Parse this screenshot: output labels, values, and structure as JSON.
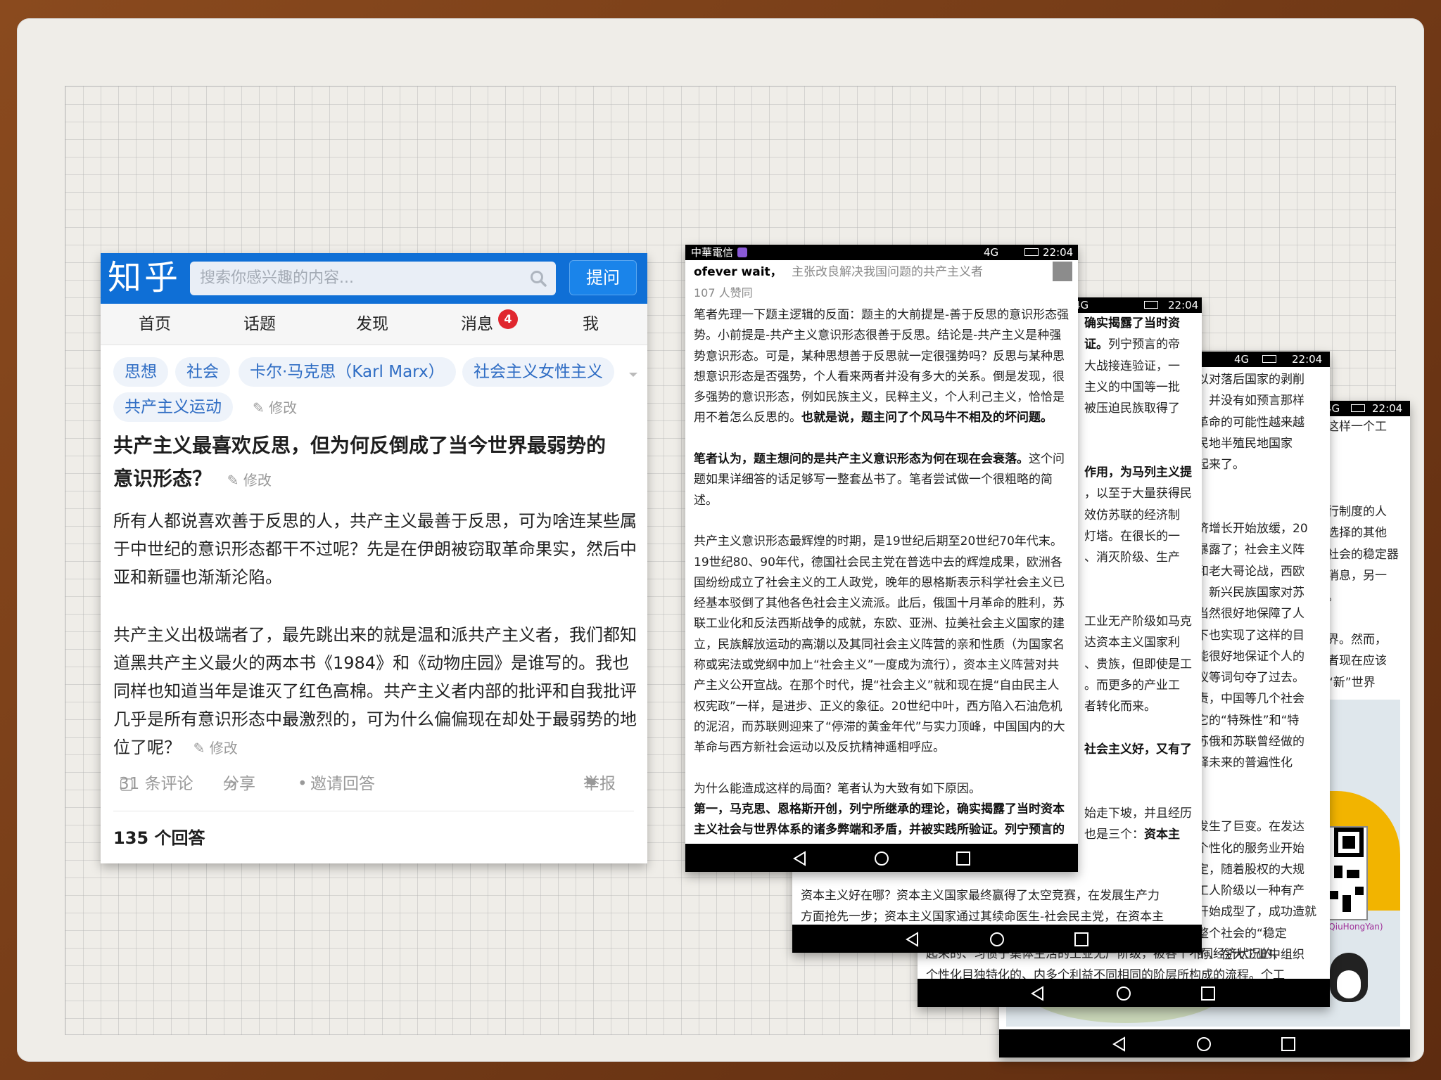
{
  "zhihu": {
    "logo": "知乎",
    "search_placeholder": "搜索你感兴趣的内容...",
    "ask_button": "提问",
    "nav": {
      "home": "首页",
      "topics": "话题",
      "discover": "发现",
      "messages": "消息",
      "me": "我",
      "badge": "4"
    },
    "tags": [
      "思想",
      "社会",
      "卡尔·马克思（Karl Marx）",
      "社会主义女性主义",
      "共产主义运动"
    ],
    "edit_label": "修改",
    "title_line1": "共产主义最喜欢反思，但为何反倒成了当今世界最弱势的",
    "title_line2": "意识形态？",
    "para1": "所有人都说喜欢善于反思的人，共产主义最善于反思，可为啥连某些属于中世纪的意识形态都干不过呢？先是在伊朗被窃取革命果实，然后中亚和新疆也渐渐沦陷。",
    "para2": "共产主义出极端者了，最先跳出来的就是温和派共产主义者，我们都知道黑共产主义最火的两本书《1984》和《动物庄园》是谁写的。我也同样也知道当年是谁灭了红色高棉。共产主义者内部的批评和自我批评几乎是所有意识形态中最激烈的，可为什么偏偏现在却处于最弱势的地位了呢？",
    "comments": "31 条评论",
    "share": "分享",
    "dot": "•",
    "invite": "邀请回答",
    "report": "举报",
    "answer_count": "135 个回答"
  },
  "shot1": {
    "carrier": "中華電信",
    "net": "4G",
    "time": "22:04",
    "author": "ofever wait，",
    "bio": "主张改良解决我国问题的共产主义者",
    "likes": "107 人赞同",
    "p1": "笔者先理一下题主逻辑的反面：题主的大前提是-善于反思的意识形态强势。小前提是-共产主义意识形态很善于反思。结论是-共产主义是种强势意识形态。可是，某种思想善于反思就一定很强势吗？反思与某种思想意识形态是否强势，个人看来两者并没有多大的关系。倒是发现，很多强势的意识形态，例如民族主义，民粹主义，个人利己主义，恰恰是用不着怎么反思的。",
    "p1b": "也就是说，题主问了个风马牛不相及的坏问题。",
    "p2b": "笔者认为，题主想问的是共产主义意识形态为何在现在会衰落。",
    "p2": "这个问题如果详细答的话足够写一整套丛书了。笔者尝试做一个很粗略的简述。",
    "p3": "共产主义意识形态最辉煌的时期，是19世纪后期至20世纪70年代末。19世纪80、90年代，德国社会民主党在普选中去的辉煌成果，欧洲各国纷纷成立了社会主义的工人政党，晚年的恩格斯表示科学社会主义已经基本驳倒了其他各色社会主义流派。此后，俄国十月革命的胜利，苏联工业化和反法西斯战争的成就，东欧、亚洲、拉美社会主义国家的建立，民族解放运动的高潮以及其同社会主义阵营的亲和性质（为国家名称或宪法或党纲中加上“社会主义”一度成为流行），资本主义阵营对共产主义公开宣战。在那个时代，提“社会主义”就和现在提“自由民主人权宪政”一样，是进步、正义的象征。20世纪中叶，西方陷入石油危机的泥沼，而苏联则迎来了“停滞的黄金年代”与实力顶峰，中国国内的大革命与西方新社会运动以及反抗精神遥相呼应。",
    "p4": "为什么能造成这样的局面？笔者认为大致有如下原因。",
    "p5b": "第一，马克思、恩格斯开创，列宁所继承的理论，确实揭露了当时资本主义社会与世界体系的诸多弊端和矛盾，并被实践所验证。列宁预言的帝"
  },
  "shot2": {
    "net": "4G",
    "time": "22:04",
    "lines": [
      {
        "b": "确实揭露了当时资",
        "t": ""
      },
      {
        "b": "证。",
        "t": "列宁预言的帝"
      },
      {
        "b": "",
        "t": "大战接连验证，一"
      },
      {
        "b": "",
        "t": "主义的中国等一批"
      },
      {
        "b": "",
        "t": "被压迫民族取得了"
      },
      {
        "b": "",
        "t": ""
      },
      {
        "b": "",
        "t": ""
      },
      {
        "b": "作用，为马列主义提",
        "t": ""
      },
      {
        "b": "",
        "t": "，以至于大量获得民"
      },
      {
        "b": "",
        "t": "效仿苏联的经济制"
      },
      {
        "b": "",
        "t": "灯塔。在很长的一"
      },
      {
        "b": "",
        "t": "、消灭阶级、生产"
      },
      {
        "b": "",
        "t": ""
      },
      {
        "b": "",
        "t": ""
      },
      {
        "b": "",
        "t": "工业无产阶级如马克"
      },
      {
        "b": "",
        "t": "达资本主义国家利"
      },
      {
        "b": "",
        "t": "、贵族，但即使是工"
      },
      {
        "b": "",
        "t": "。而更多的产业工"
      },
      {
        "b": "",
        "t": "者转化而来。"
      },
      {
        "b": "",
        "t": ""
      },
      {
        "b": "社会主义好，又有了",
        "t": ""
      },
      {
        "b": "",
        "t": ""
      },
      {
        "b": "",
        "t": ""
      },
      {
        "b": "",
        "t": "始走下坡，并且经历"
      },
      {
        "b": "资本主",
        "t": "也是三个："
      }
    ],
    "bottom1": "资本主义好在哪？资本主义国家最终赢得了太空竞赛，在发展生产力",
    "bottom2": "方面抢先一步；资本主义国家通过其续命医生-社会民主党，在资本主"
  },
  "shot3": {
    "net": "4G",
    "time": "22:04",
    "lines": [
      "以对落后国家的剥削",
      "，并没有如预言那样",
      "革命的可能性越来越",
      "民地半殖民地国家",
      "起来了。",
      "",
      "",
      "济增长开始放缓，20",
      "暴露了；社会主义阵",
      "和老大哥论战，西欧",
      "，新兴民族国家对苏",
      "当然很好地保障了人",
      "下也实现了这样的目",
      "能很好地保证个人的",
      "议等词句夺了过去。",
      "责，中国等几个社会",
      "它的“特殊性”和“特",
      "苏俄和苏联曾经做的",
      "释未来的普遍性化",
      "",
      "",
      "发生了巨变。在发达",
      "个性化的服务业开始",
      "定，随着股权的大规",
      "工人阶级以一种有产",
      "开始成型了，成功造就",
      "整个社会的“稳定",
      "的、在大工业中组织"
    ],
    "bottom1": "起来的、习惯于集体生活的工业无产阶级，被各个不同经济状况的、",
    "bottom2": "个性化目独特化的、内多个利益不同相同的阶层所构成的流程。个工"
  },
  "shot4": {
    "net": "4G",
    "time": "22:04",
    "lines": [
      "这样一个工",
      "",
      "",
      "",
      "行制度的人",
      "选择的其他",
      "社会的稳定器",
      "消息，另一",
      "。",
      "",
      "界。然而，",
      "者现在应该",
      "“新”世界"
    ],
    "watermark": "ianQiuHongYan)"
  }
}
